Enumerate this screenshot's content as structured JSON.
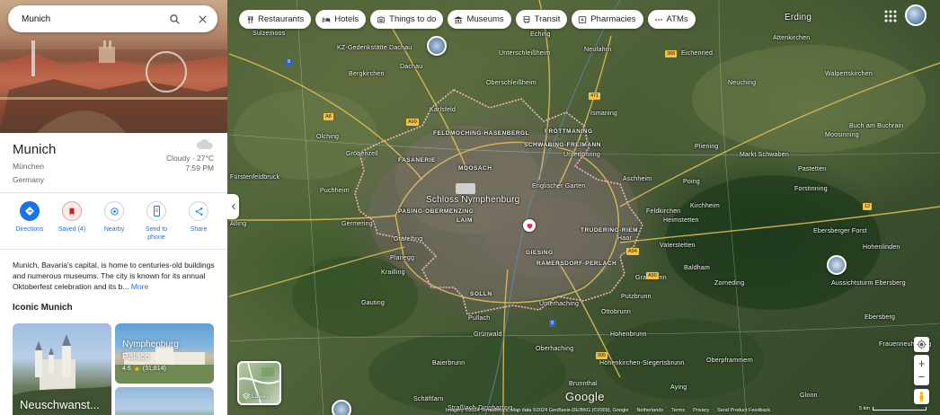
{
  "search": {
    "value": "Munich"
  },
  "chips": [
    {
      "label": "Restaurants",
      "icon": "fork-knife-icon"
    },
    {
      "label": "Hotels",
      "icon": "bed-icon"
    },
    {
      "label": "Things to do",
      "icon": "camera-icon"
    },
    {
      "label": "Museums",
      "icon": "museum-icon"
    },
    {
      "label": "Transit",
      "icon": "train-icon"
    },
    {
      "label": "Pharmacies",
      "icon": "pharmacy-icon"
    },
    {
      "label": "ATMs",
      "icon": "more-icon"
    }
  ],
  "place": {
    "name": "Munich",
    "local_name": "München",
    "country": "Germany",
    "weather": {
      "condition": "Cloudy · 27°C",
      "time": "7:59 PM"
    },
    "description": "Munich, Bavaria's capital, is home to centuries-old buildings and numerous museums. The city is known for its annual Oktoberfest celebration and its b...",
    "more_label": "More"
  },
  "actions": [
    {
      "label": "Directions",
      "icon": "directions-icon"
    },
    {
      "label": "Saved (4)",
      "icon": "bookmark-icon"
    },
    {
      "label": "Nearby",
      "icon": "nearby-icon"
    },
    {
      "label": "Send to phone",
      "icon": "phone-icon"
    },
    {
      "label": "Share",
      "icon": "share-icon"
    }
  ],
  "iconic": {
    "title": "Iconic Munich",
    "cards": [
      {
        "title": "Neuschwanst..."
      },
      {
        "title": "Nymphenburg Palace",
        "rating": "4.6",
        "reviews": "(31,814)"
      },
      {
        "title": ""
      }
    ]
  },
  "map": {
    "places": [
      {
        "name": "Sulzemoos"
      },
      {
        "name": "KZ-Gedenkstätte Dachau"
      },
      {
        "name": "Dachau"
      },
      {
        "name": "Bergkirchen"
      },
      {
        "name": "Oberschleißheim"
      },
      {
        "name": "Unterschleißheim"
      },
      {
        "name": "Eching"
      },
      {
        "name": "Neufahrn"
      },
      {
        "name": "Eichenried"
      },
      {
        "name": "Erding"
      },
      {
        "name": "Attenkirchen"
      },
      {
        "name": "Walpertskirchen"
      },
      {
        "name": "Neuching"
      },
      {
        "name": "Aschheim"
      },
      {
        "name": "Karlsfeld"
      },
      {
        "name": "Olching"
      },
      {
        "name": "Gröbenzell"
      },
      {
        "name": "Puchheim"
      },
      {
        "name": "Germering"
      },
      {
        "name": "Gräfelfing"
      },
      {
        "name": "Planegg"
      },
      {
        "name": "Krailling"
      },
      {
        "name": "Gauting"
      },
      {
        "name": "Pullach"
      },
      {
        "name": "Grünwald"
      },
      {
        "name": "Unterhaching"
      },
      {
        "name": "Ottobrunn"
      },
      {
        "name": "Putzbrunn"
      },
      {
        "name": "Vaterstetten"
      },
      {
        "name": "Baldham"
      },
      {
        "name": "Grasbrunn"
      },
      {
        "name": "Hohenlinden"
      },
      {
        "name": "Markt Schwaben"
      },
      {
        "name": "Pliening"
      },
      {
        "name": "Poing"
      },
      {
        "name": "Zorneding"
      },
      {
        "name": "Baierbrunn"
      },
      {
        "name": "Schäftlarn"
      },
      {
        "name": "Hohenbrunn"
      },
      {
        "name": "Höhenkirchen-Siegertsbrunn"
      },
      {
        "name": "Oberpframmern"
      },
      {
        "name": "Brunnthal"
      },
      {
        "name": "Straßlach-Dingharting"
      },
      {
        "name": "Aying"
      },
      {
        "name": "Glonn"
      },
      {
        "name": "Ebersberger Forst"
      },
      {
        "name": "Aussichtsturm Ebersberg"
      },
      {
        "name": "Ebersberg"
      },
      {
        "name": "Feldkirchen"
      },
      {
        "name": "Forstinning"
      },
      {
        "name": "Moosinning"
      },
      {
        "name": "Fürstenfeldbruck"
      },
      {
        "name": "Alling"
      },
      {
        "name": "Oberhaching"
      },
      {
        "name": "Ismaning"
      },
      {
        "name": "Unterföhring"
      },
      {
        "name": "Buch am Buchrain"
      },
      {
        "name": "Pastetten"
      },
      {
        "name": "Kirchheim"
      },
      {
        "name": "Heimstetten"
      },
      {
        "name": "Haar"
      },
      {
        "name": "Frauenneuharting"
      },
      {
        "name": "Schloss Nymphenburg"
      },
      {
        "name": "Englischer Garten"
      }
    ],
    "districts": [
      "FELDMOCHING-HASENBERGL",
      "SCHWABING-FREIMANN",
      "MOOSACH",
      "PASING-OBERMENZING",
      "LAIM",
      "TRUDERING-RIEM",
      "GIESING",
      "RAMERSDORF-PERLACH",
      "SOLLN",
      "FRÖTTMANING",
      "FASANERIE"
    ],
    "google_logo": "Google",
    "attribution": [
      "Imagery ©2024 TerraMetrics, Map data ©2024 GeoBasis-DE/BKG (©2009), Google",
      "Netherlands",
      "Terms",
      "Privacy",
      "Send Product Feedback"
    ],
    "scale": "5 km",
    "layers_label": "Layers"
  },
  "colors": {
    "accent": "#1a73e8",
    "boundary": "#f4b6c2"
  }
}
